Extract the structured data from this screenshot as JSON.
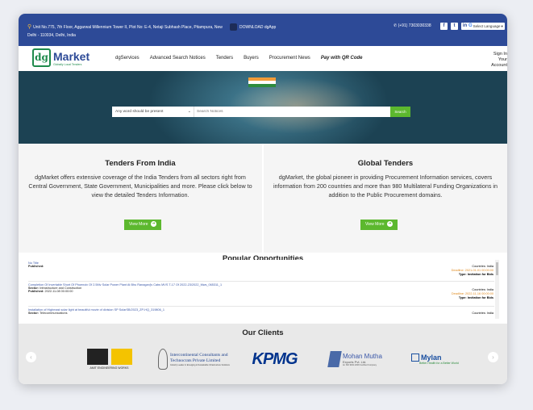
{
  "colors": {
    "topbar": "#2d4a97",
    "accent_green": "#5cb82e",
    "link": "#3a57a8",
    "deadline": "#e08a1e"
  },
  "topbar": {
    "address_line1": "Unit No.775, 7th Floor, Aggarwal Millennium Tower II, Plot No: E-4, Netaji Subhash Place, Pitampura, New",
    "address_line2": "Delhi - 110034, Delhi, India",
    "download": "DOWNLOAD dgApp",
    "phone": "(+91) 7303030338",
    "social": [
      "f",
      "t",
      "in"
    ],
    "language": "Select Language"
  },
  "nav": {
    "logo_dg": "dg",
    "logo_market": "Market",
    "logo_tagline": "Globally Local Tenders",
    "items": [
      "dgServices",
      "Advanced Search Notices",
      "Tenders",
      "Buyers",
      "Procurement News",
      "Pay with QR Code"
    ],
    "signin_line1": "Sign In",
    "signin_line2": "Your Account"
  },
  "search": {
    "select_value": "Any word should be present",
    "placeholder": "Search Notices",
    "button": "Search"
  },
  "cards": [
    {
      "title": "Tenders From India",
      "text": "dgMarket offers extensive coverage of the India Tenders from all sectors right from Central Government, State Government, Municipalities and more. Please click below to view the detailed Tenders Information.",
      "button": "View More"
    },
    {
      "title": "Global Tenders",
      "text": "dgMarket, the global pioneer in providing Procurement Information services, covers information from 200 countries and more than 980 Multilateral Funding Organizations in addition to the Public Procurement domains.",
      "button": "View More"
    }
  ],
  "popular": {
    "title": "Popular Opportunities",
    "items": [
      {
        "title": "No Title",
        "sector_label": "",
        "sector": "",
        "published_label": "Published:",
        "published": "",
        "countries": "Countries: India",
        "deadline": "Deadline: 2021-01-01 00:00:00",
        "type": "Type: Invitation for Bids"
      },
      {
        "title": "Completion Of Invertable Short Of Phoenoix Of 2.5Mv Solar Power Plant At Bhu Ranaganj's Cabs MVS T-17 Of 2022-23/2022_Mws_065311_1",
        "sector_label": "Sector:",
        "sector": "Infrastructure and Construction",
        "published_label": "Published:",
        "published": "2022-11-08 00:00:00",
        "countries": "Countries: India",
        "deadline": "Deadline: 2022-11-16 00:00:00",
        "type": "Type: Invitation for Bids"
      },
      {
        "title": "Installation of Highmast solar light at beautiful movie of division SP SolarSB/2023_ZP-HQ_319806_1",
        "sector_label": "Sector:",
        "sector": "Telecommunications",
        "published_label": "",
        "published": "",
        "countries": "Countries: India",
        "deadline": "",
        "type": ""
      }
    ]
  },
  "clients": {
    "title": "Our Clients",
    "logos": [
      {
        "name": "AMIT ENGINEERING WORKS"
      },
      {
        "name_line1": "Intercontinental Consultants and",
        "name_line2": "Technocrats Private Limited",
        "sub": "Industry Leader in Emerging & Sustainable Infrastructure Solutions"
      },
      {
        "name": "KPMG"
      },
      {
        "name_line1": "Mohan Mutha",
        "name_line2": "Exports Pvt. Ltd.",
        "sub": "An ISO 9001:2008 Certified Company"
      },
      {
        "name": "Mylan",
        "tagline": "Better Health for a Better World"
      }
    ]
  }
}
